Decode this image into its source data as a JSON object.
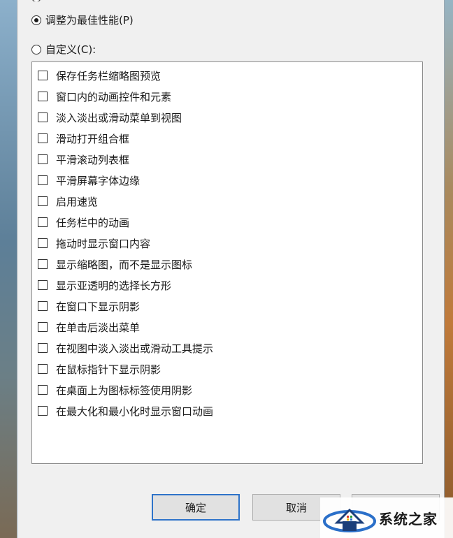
{
  "radio_options": {
    "best_performance": {
      "label": "调整为最佳性能(P)",
      "checked": true
    },
    "custom": {
      "label": "自定义(C):",
      "checked": false
    }
  },
  "effects": [
    "保存任务栏缩略图预览",
    "窗口内的动画控件和元素",
    "淡入淡出或滑动菜单到视图",
    "滑动打开组合框",
    "平滑滚动列表框",
    "平滑屏幕字体边缘",
    "启用速览",
    "任务栏中的动画",
    "拖动时显示窗口内容",
    "显示缩略图，而不是显示图标",
    "显示亚透明的选择长方形",
    "在窗口下显示阴影",
    "在单击后淡出菜单",
    "在视图中淡入淡出或滑动工具提示",
    "在鼠标指针下显示阴影",
    "在桌面上为图标标签使用阴影",
    "在最大化和最小化时显示窗口动画"
  ],
  "buttons": {
    "ok": "确定",
    "cancel": "取消"
  },
  "watermark": {
    "text": "系统之家",
    "logo_icon": "house-logo-icon"
  },
  "colors": {
    "dialog_bg": "#f0f0f0",
    "default_button_border": "#2e73c9"
  }
}
